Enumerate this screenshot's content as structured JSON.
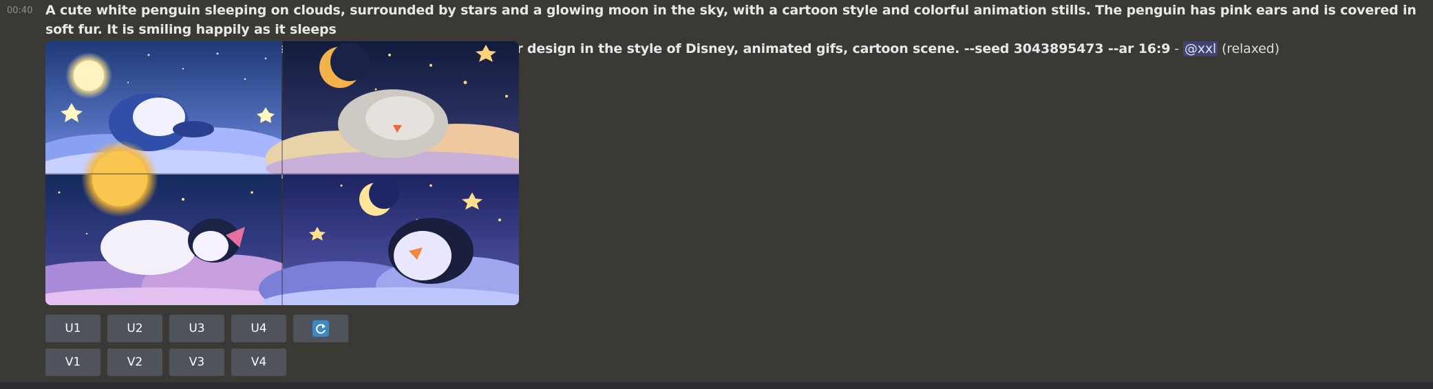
{
  "message": {
    "timestamp": "00:40",
    "prompt_line1": "A cute white penguin sleeping on clouds, surrounded by stars and a glowing moon in the sky, with a cartoon style and colorful animation stills. The penguin has pink ears and is covered in soft fur. It is smiling happily as it sleeps",
    "prompt_line2": "peacefully under twinkling lights, focus stacked, with a character design in the style of Disney, animated gifs, cartoon scene. --seed 3043895473 --ar 16:9",
    "separator": " - ",
    "mention": "@xxl",
    "status": " (relaxed)"
  },
  "image": {
    "description_panels": [
      "penguin-full-moon",
      "lamb-crescent-moon",
      "penguin-golden-moon",
      "penguin-crescent-stars"
    ]
  },
  "buttons": {
    "upscale": [
      "U1",
      "U2",
      "U3",
      "U4"
    ],
    "reroll_icon": "refresh-icon",
    "variation": [
      "V1",
      "V2",
      "V3",
      "V4"
    ]
  },
  "colors": {
    "background": "#3b3936",
    "button": "#4f545c",
    "mention_bg": "#5865f24d",
    "refresh_icon": "#3b88c3"
  }
}
